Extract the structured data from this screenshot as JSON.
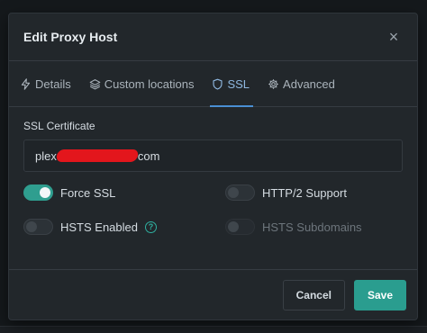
{
  "modal": {
    "title": "Edit Proxy Host",
    "close_glyph": "×"
  },
  "tabs": [
    {
      "label": "Details",
      "icon": "bolt-icon"
    },
    {
      "label": "Custom locations",
      "icon": "layers-icon"
    },
    {
      "label": "SSL",
      "icon": "shield-icon",
      "active": true
    },
    {
      "label": "Advanced",
      "icon": "gear-icon"
    }
  ],
  "ssl": {
    "certificate_label": "SSL Certificate",
    "certificate_prefix": "plex",
    "certificate_suffix": "com"
  },
  "toggles": {
    "force_ssl": {
      "label": "Force SSL",
      "on": true
    },
    "http2": {
      "label": "HTTP/2 Support",
      "on": false
    },
    "hsts": {
      "label": "HSTS Enabled",
      "on": false
    },
    "hsts_sub": {
      "label": "HSTS Subdomains",
      "on": false,
      "disabled": true
    },
    "help_glyph": "?"
  },
  "footer": {
    "cancel_label": "Cancel",
    "save_label": "Save"
  },
  "colors": {
    "accent": "#2a9d8f",
    "tab_active": "#4a8fd4",
    "redaction": "#e3161c"
  }
}
